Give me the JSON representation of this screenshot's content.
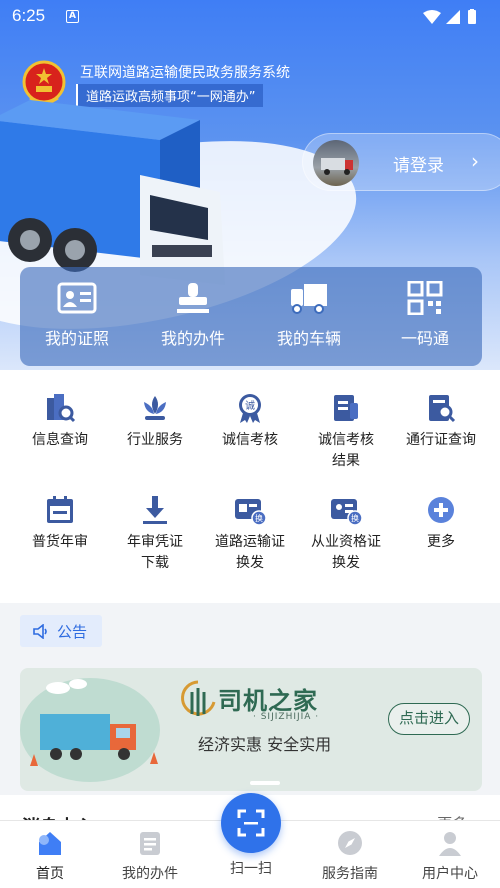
{
  "status_bar": {
    "time": "6:25",
    "app_glyph": "A"
  },
  "header": {
    "system_title": "互联网道路运输便民政务服务系统",
    "system_subtitle": "道路运政高频事项“一网通办”",
    "emblem_icon": "national-emblem-icon"
  },
  "login": {
    "label": "请登录",
    "chevron": "›"
  },
  "quick_actions": [
    {
      "label": "我的证照",
      "icon": "id-card-icon"
    },
    {
      "label": "我的办件",
      "icon": "stamp-icon"
    },
    {
      "label": "我的车辆",
      "icon": "truck-icon"
    },
    {
      "label": "一码通",
      "icon": "qr-code-icon"
    }
  ],
  "services_row1": [
    {
      "label": "信息查询",
      "icon": "building-search-icon"
    },
    {
      "label": "行业服务",
      "icon": "lotus-icon"
    },
    {
      "label": "诚信考核",
      "icon": "credit-badge-icon",
      "badge": "诚"
    },
    {
      "label_line1": "诚信考核",
      "label_line2": "结果",
      "icon": "document-result-icon"
    },
    {
      "label": "通行证查询",
      "icon": "pass-search-icon"
    }
  ],
  "services_row2": [
    {
      "label": "普货年审",
      "icon": "calendar-icon"
    },
    {
      "label_line1": "年审凭证",
      "label_line2": "下载",
      "icon": "download-icon"
    },
    {
      "label_line1": "道路运输证",
      "label_line2": "换发",
      "icon": "card-exchange-icon",
      "badge": "换"
    },
    {
      "label_line1": "从业资格证",
      "label_line2": "换发",
      "icon": "qualification-exchange-icon",
      "badge": "换"
    },
    {
      "label": "更多",
      "icon": "plus-circle-icon"
    }
  ],
  "notice": {
    "label": "公告",
    "icon": "speaker-icon"
  },
  "banner": {
    "brand": "司机之家",
    "brand_sub": "· SIJIZHIJIA ·",
    "slogan": "经济实惠 安全实用",
    "button": "点击进入"
  },
  "messages": {
    "title": "消息中心",
    "more": "更多 ›"
  },
  "bottom_nav": [
    {
      "label": "首页",
      "icon": "home-icon",
      "active": true
    },
    {
      "label": "我的办件",
      "icon": "document-list-icon"
    },
    {
      "label": "扫一扫",
      "icon": "scan-icon"
    },
    {
      "label": "服务指南",
      "icon": "compass-icon"
    },
    {
      "label": "用户中心",
      "icon": "user-icon"
    }
  ],
  "colors": {
    "primary": "#2f72ea",
    "hero_top": "#3f7ef5",
    "banner_green": "#2f6a53",
    "quick_panel": "#3d6cbc"
  }
}
